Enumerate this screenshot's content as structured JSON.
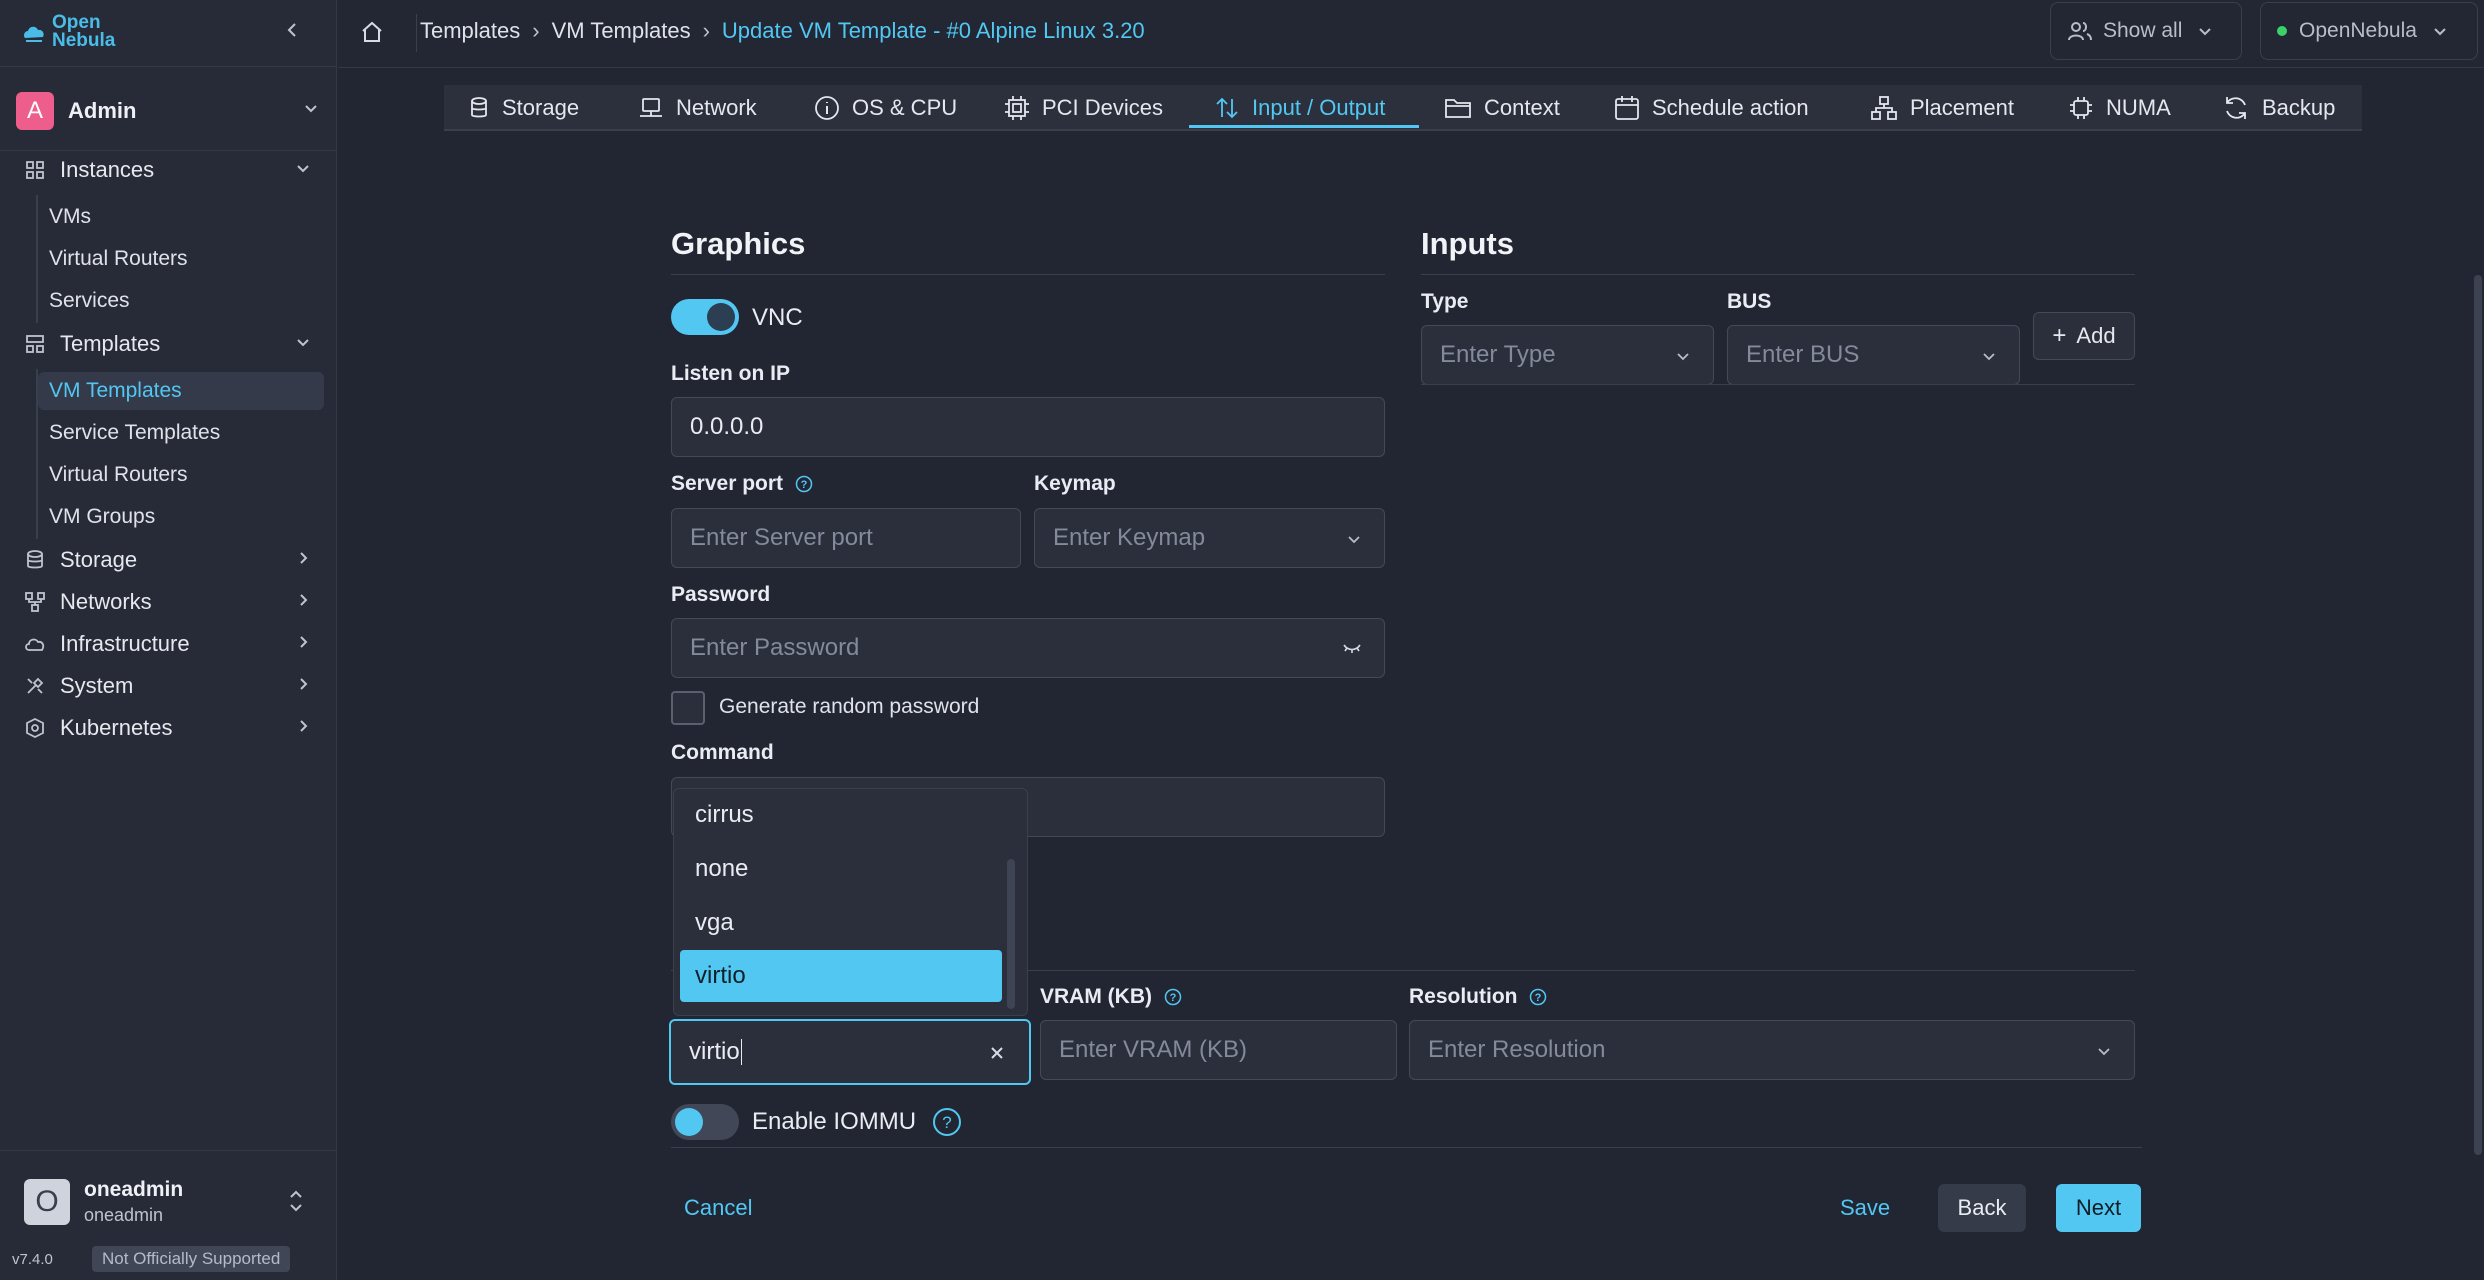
{
  "app": {
    "logo_line1": "Open",
    "logo_line2": "Nebula"
  },
  "sidebar": {
    "group_selector": "Admin",
    "group_avatar": "A",
    "instances": {
      "label": "Instances",
      "items": [
        "VMs",
        "Virtual Routers",
        "Services"
      ]
    },
    "templates": {
      "label": "Templates",
      "items": [
        "VM Templates",
        "Service Templates",
        "Virtual Routers",
        "VM Groups"
      ]
    },
    "groups": [
      "Storage",
      "Networks",
      "Infrastructure",
      "System",
      "Kubernetes"
    ],
    "user": {
      "avatar": "O",
      "name": "oneadmin",
      "sub": "oneadmin"
    },
    "version": "v7.4.0",
    "support_badge": "Not Officially Supported"
  },
  "topbar": {
    "breadcrumbs": [
      "Templates",
      "VM Templates",
      "Update VM Template - #0 Alpine Linux 3.20"
    ],
    "show_all": "Show all",
    "zone": "OpenNebula"
  },
  "tabs": [
    {
      "label": "Storage",
      "icon": "storage-icon"
    },
    {
      "label": "Network",
      "icon": "network-icon"
    },
    {
      "label": "OS & CPU",
      "icon": "info-icon"
    },
    {
      "label": "PCI Devices",
      "icon": "chip-icon"
    },
    {
      "label": "Input / Output",
      "icon": "arrows-updown-icon"
    },
    {
      "label": "Context",
      "icon": "folder-icon"
    },
    {
      "label": "Schedule action",
      "icon": "calendar-icon"
    },
    {
      "label": "Placement",
      "icon": "hierarchy-icon"
    },
    {
      "label": "NUMA",
      "icon": "cpu-icon"
    },
    {
      "label": "Backup",
      "icon": "refresh-icon"
    }
  ],
  "graphics": {
    "title": "Graphics",
    "vnc_label": "VNC",
    "vnc_enabled": true,
    "listen_label": "Listen on IP",
    "listen_value": "0.0.0.0",
    "port_label": "Server port",
    "port_placeholder": "Enter Server port",
    "keymap_label": "Keymap",
    "keymap_placeholder": "Enter Keymap",
    "password_label": "Password",
    "password_placeholder": "Enter Password",
    "random_password_label": "Generate random password",
    "command_label": "Command"
  },
  "video": {
    "options": [
      "cirrus",
      "none",
      "vga",
      "virtio"
    ],
    "selected": "virtio",
    "input_value": "virtio",
    "vram_label": "VRAM (KB)",
    "vram_placeholder": "Enter VRAM (KB)",
    "resolution_label": "Resolution",
    "resolution_placeholder": "Enter Resolution",
    "iommu_label": "Enable IOMMU",
    "iommu_enabled": false
  },
  "inputs": {
    "title": "Inputs",
    "type_label": "Type",
    "type_placeholder": "Enter Type",
    "bus_label": "BUS",
    "bus_placeholder": "Enter BUS",
    "add_label": "Add"
  },
  "footer": {
    "cancel": "Cancel",
    "save": "Save",
    "back": "Back",
    "next": "Next"
  },
  "colors": {
    "accent": "#52c7f2",
    "background": "#222632",
    "sidebar": "#272b37",
    "avatar_admin": "#ee5e8c",
    "online": "#3ad06a"
  }
}
